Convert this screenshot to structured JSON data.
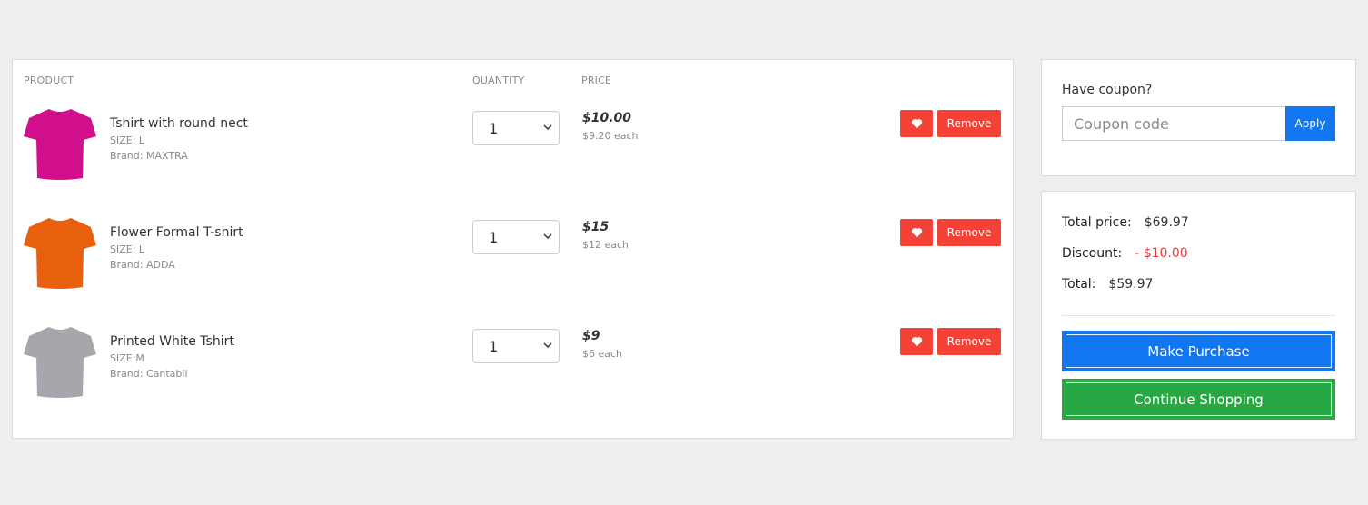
{
  "table": {
    "headers": {
      "product": "PRODUCT",
      "quantity": "QUANTITY",
      "price": "PRICE"
    },
    "items": [
      {
        "name": "Tshirt with round nect",
        "size": "SIZE: L",
        "brand": "Brand: MAXTRA",
        "qty": "1",
        "price": "$10.00",
        "each": "$9.20 each",
        "shirt_color": "#d10f8c",
        "remove_label": "Remove"
      },
      {
        "name": "Flower Formal T-shirt",
        "size": "SIZE: L",
        "brand": "Brand: ADDA",
        "qty": "1",
        "price": "$15",
        "each": "$12 each",
        "shirt_color": "#e8600e",
        "remove_label": "Remove"
      },
      {
        "name": "Printed White Tshirt",
        "size": "SIZE:M",
        "brand": "Brand: Cantabil",
        "qty": "1",
        "price": "$9",
        "each": "$6 each",
        "shirt_color": "#a6a6ac",
        "remove_label": "Remove"
      }
    ]
  },
  "coupon": {
    "label": "Have coupon?",
    "placeholder": "Coupon code",
    "apply_label": "Apply"
  },
  "summary": {
    "total_price_label": "Total price:",
    "total_price_value": "$69.97",
    "discount_label": "Discount:",
    "discount_value": "- $10.00",
    "total_label": "Total:",
    "total_value": "$59.97",
    "purchase_label": "Make Purchase",
    "continue_label": "Continue Shopping"
  },
  "colors": {
    "danger": "#f44336",
    "primary": "#1176f0",
    "success": "#28a745",
    "page_bg": "#eeeeee"
  }
}
